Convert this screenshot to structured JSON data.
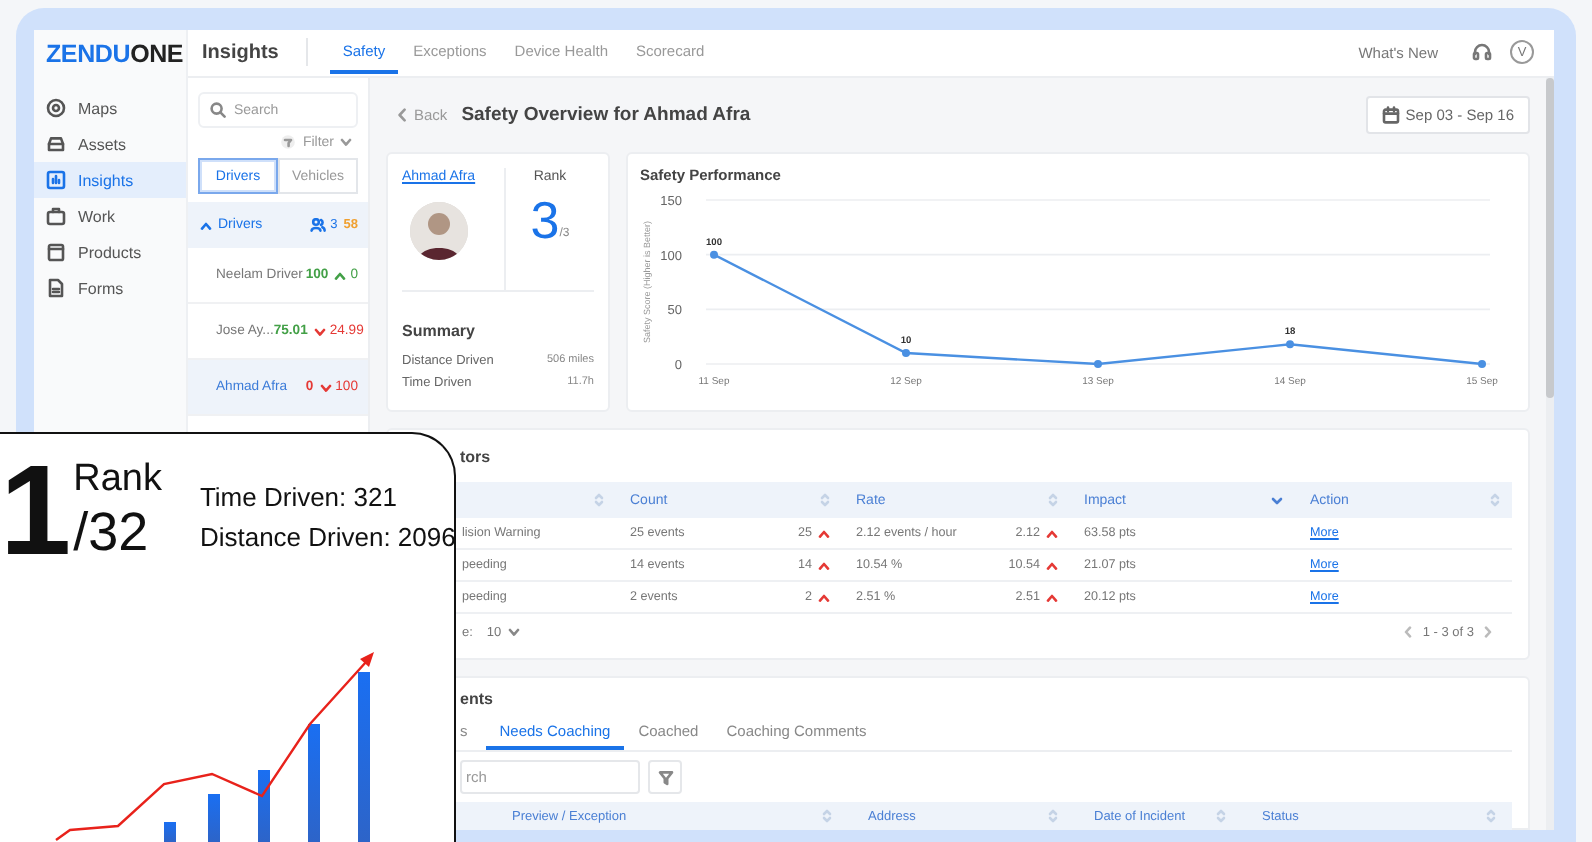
{
  "logo": {
    "brand": "ZENDU",
    "suffix": "ONE"
  },
  "sidebar": {
    "items": [
      {
        "label": "Maps",
        "selected": false
      },
      {
        "label": "Assets",
        "selected": false
      },
      {
        "label": "Insights",
        "selected": true
      },
      {
        "label": "Work",
        "selected": false
      },
      {
        "label": "Products",
        "selected": false
      },
      {
        "label": "Forms",
        "selected": false
      }
    ]
  },
  "header": {
    "title": "Insights",
    "tabs": [
      {
        "label": "Safety",
        "selected": true
      },
      {
        "label": "Exceptions",
        "selected": false
      },
      {
        "label": "Device Health",
        "selected": false
      },
      {
        "label": "Scorecard",
        "selected": false
      }
    ],
    "whats_new": "What's New",
    "avatar": "V"
  },
  "drivers_panel": {
    "search": {
      "placeholder": "Search"
    },
    "filter": "Filter",
    "toggle": [
      {
        "label": "Drivers",
        "selected": true
      },
      {
        "label": "Vehicles",
        "selected": false
      }
    ],
    "group": {
      "label": "Drivers",
      "expanded": true,
      "count": "3",
      "score": "58"
    },
    "rows": [
      {
        "name": "Neelam Driver",
        "score": "100",
        "color": "#43a047",
        "increase": true,
        "change": "0",
        "selected": false
      },
      {
        "name": "Jose Ay...",
        "score": "75.01",
        "color": "#43a047",
        "increase": false,
        "change": "24.99",
        "selected": false
      },
      {
        "name": "Ahmad Afra",
        "score": "0",
        "color": "#e53935",
        "increase": false,
        "change": "100",
        "selected": true
      }
    ]
  },
  "overview": {
    "back": "Back",
    "title": "Safety Overview for Ahmad Afra",
    "date_range": "Sep 03 - Sep 16",
    "profile": {
      "name": "Ahmad Afra",
      "rank_label": "Rank",
      "rank": "3",
      "rank_total": "/3",
      "summary_title": "Summary",
      "summary": [
        {
          "label": "Distance Driven",
          "value": "506 miles"
        },
        {
          "label": "Time Driven",
          "value": "11.7h"
        }
      ]
    },
    "performance": {
      "title": "Safety Performance",
      "chart_data": {
        "type": "line",
        "ylabel": "Safety Score (Higher is Better)",
        "categories": [
          "11 Sep",
          "12 Sep",
          "13 Sep",
          "14 Sep",
          "15 Sep"
        ],
        "ylim": [
          0,
          150
        ],
        "yticks": [
          0,
          50,
          100,
          150
        ],
        "series": [
          {
            "color": "#4a90e2",
            "marker": true,
            "values": [
              100,
              10,
              0,
              18,
              0
            ]
          }
        ],
        "value_labels": [
          "100",
          "10",
          null,
          "18",
          null
        ]
      }
    }
  },
  "indicators": {
    "title": "tors",
    "columns": [
      {
        "label": "Count",
        "sorted": false
      },
      {
        "label": "Rate",
        "sorted": false
      },
      {
        "label": "Impact",
        "sorted": true
      },
      {
        "label": "Action",
        "sorted": false
      }
    ],
    "rows": [
      {
        "name": "lision Warning",
        "count": "25 events",
        "count_change": "25",
        "rate": "2.12 events / hour",
        "rate_change": "2.12",
        "increase": true,
        "impact": "63.58 pts",
        "action": "More"
      },
      {
        "name": "peeding",
        "count": "14 events",
        "count_change": "14",
        "rate": "10.54 %",
        "rate_change": "10.54",
        "increase": true,
        "impact": "21.07 pts",
        "action": "More"
      },
      {
        "name": "peeding",
        "count": "2 events",
        "count_change": "2",
        "rate": "2.51 %",
        "rate_change": "2.51",
        "increase": true,
        "impact": "20.12 pts",
        "action": "More"
      }
    ],
    "rows_per_page": {
      "label": "e:",
      "value": "10"
    },
    "pagination": "1 - 3 of 3"
  },
  "events": {
    "title": "ents",
    "tabs": [
      {
        "label": "s",
        "selected": false
      },
      {
        "label": "Needs Coaching",
        "selected": true
      },
      {
        "label": "Coached",
        "selected": false
      },
      {
        "label": "Coaching Comments",
        "selected": false
      }
    ],
    "search": {
      "placeholder": "rch"
    },
    "columns": [
      "Preview / Exception",
      "Address",
      "Date of Incident",
      "Status"
    ]
  },
  "promo_card": {
    "rank": "1",
    "rank_label": "Rank",
    "rank_total": "/32",
    "stats": [
      "Time Driven: 321",
      "Distance Driven: 2096"
    ]
  }
}
